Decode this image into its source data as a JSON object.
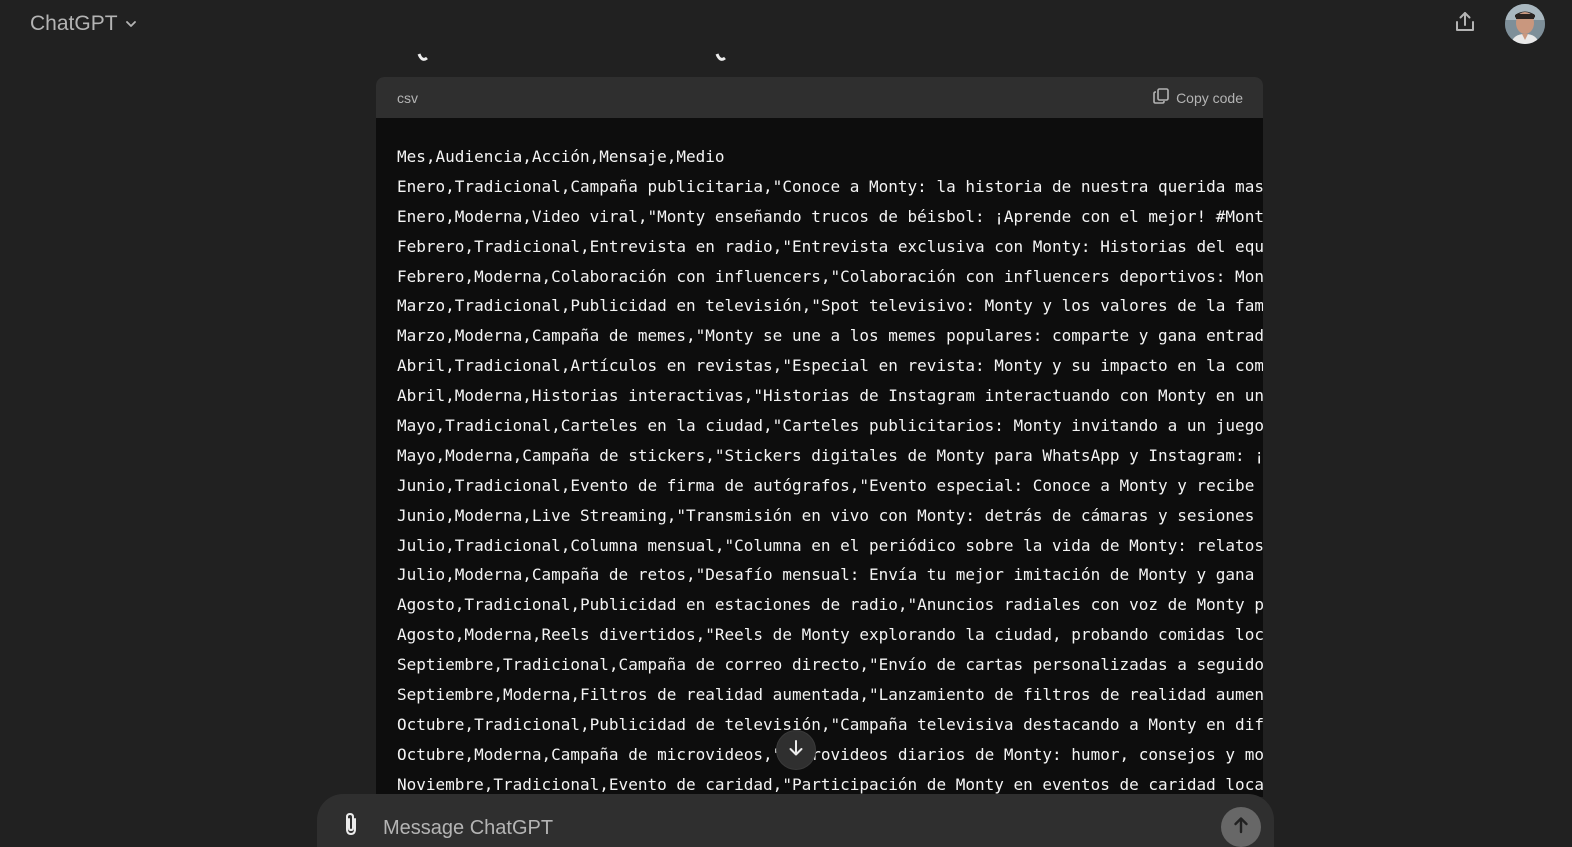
{
  "header": {
    "model_name": "ChatGPT",
    "icons": {
      "chevron": "chevron-down-icon",
      "share": "share-icon",
      "avatar": "avatar"
    }
  },
  "code_block": {
    "language": "csv",
    "copy_label": "Copy code",
    "lines": [
      "Mes,Audiencia,Acción,Mensaje,Medio",
      "Enero,Tradicional,Campaña publicitaria,\"Conoce a Monty: la historia de nuestra querida masc",
      "Enero,Moderna,Video viral,\"Monty enseñando trucos de béisbol: ¡Aprende con el mejor! #Monty",
      "Febrero,Tradicional,Entrevista en radio,\"Entrevista exclusiva con Monty: Historias del equi",
      "Febrero,Moderna,Colaboración con influencers,\"Colaboración con influencers deportivos: Mont",
      "Marzo,Tradicional,Publicidad en televisión,\"Spot televisivo: Monty y los valores de la fami",
      "Marzo,Moderna,Campaña de memes,\"Monty se une a los memes populares: comparte y gana entrad",
      "Abril,Tradicional,Artículos en revistas,\"Especial en revista: Monty y su impacto en la comu",
      "Abril,Moderna,Historias interactivas,\"Historias de Instagram interactuando con Monty en un",
      "Mayo,Tradicional,Carteles en la ciudad,\"Carteles publicitarios: Monty invitando a un juego",
      "Mayo,Moderna,Campaña de stickers,\"Stickers digitales de Monty para WhatsApp y Instagram: ¡",
      "Junio,Tradicional,Evento de firma de autógrafos,\"Evento especial: Conoce a Monty y recibe u",
      "Junio,Moderna,Live Streaming,\"Transmisión en vivo con Monty: detrás de cámaras y sesiones d",
      "Julio,Tradicional,Columna mensual,\"Columna en el periódico sobre la vida de Monty: relatos",
      "Julio,Moderna,Campaña de retos,\"Desafío mensual: Envía tu mejor imitación de Monty y gana p",
      "Agosto,Tradicional,Publicidad en estaciones de radio,\"Anuncios radiales con voz de Monty pr",
      "Agosto,Moderna,Reels divertidos,\"Reels de Monty explorando la ciudad, probando comidas loca",
      "Septiembre,Tradicional,Campaña de correo directo,\"Envío de cartas personalizadas a seguidor",
      "Septiembre,Moderna,Filtros de realidad aumentada,\"Lanzamiento de filtros de realidad aument",
      "Octubre,Tradicional,Publicidad de televisión,\"Campaña televisiva destacando a Monty en dife",
      "Octubre,Moderna,Campaña de microvideos,\"Microvideos diarios de Monty: humor, consejos y mom",
      "Noviembre,Tradicional,Evento de caridad,\"Participación de Monty en eventos de caridad local"
    ]
  },
  "scroll_button": {
    "icon": "arrow-down-icon"
  },
  "composer": {
    "placeholder": "Message ChatGPT",
    "value": "",
    "attach_icon": "paperclip-icon",
    "send_icon": "arrow-up-icon"
  },
  "colors": {
    "background": "#212121",
    "code_background": "#0d0d0d",
    "code_header": "#2f2f2f",
    "composer_background": "#2f2f2f",
    "send_button": "#676767",
    "text_primary": "#ececec",
    "text_secondary": "#b4b4b4"
  }
}
